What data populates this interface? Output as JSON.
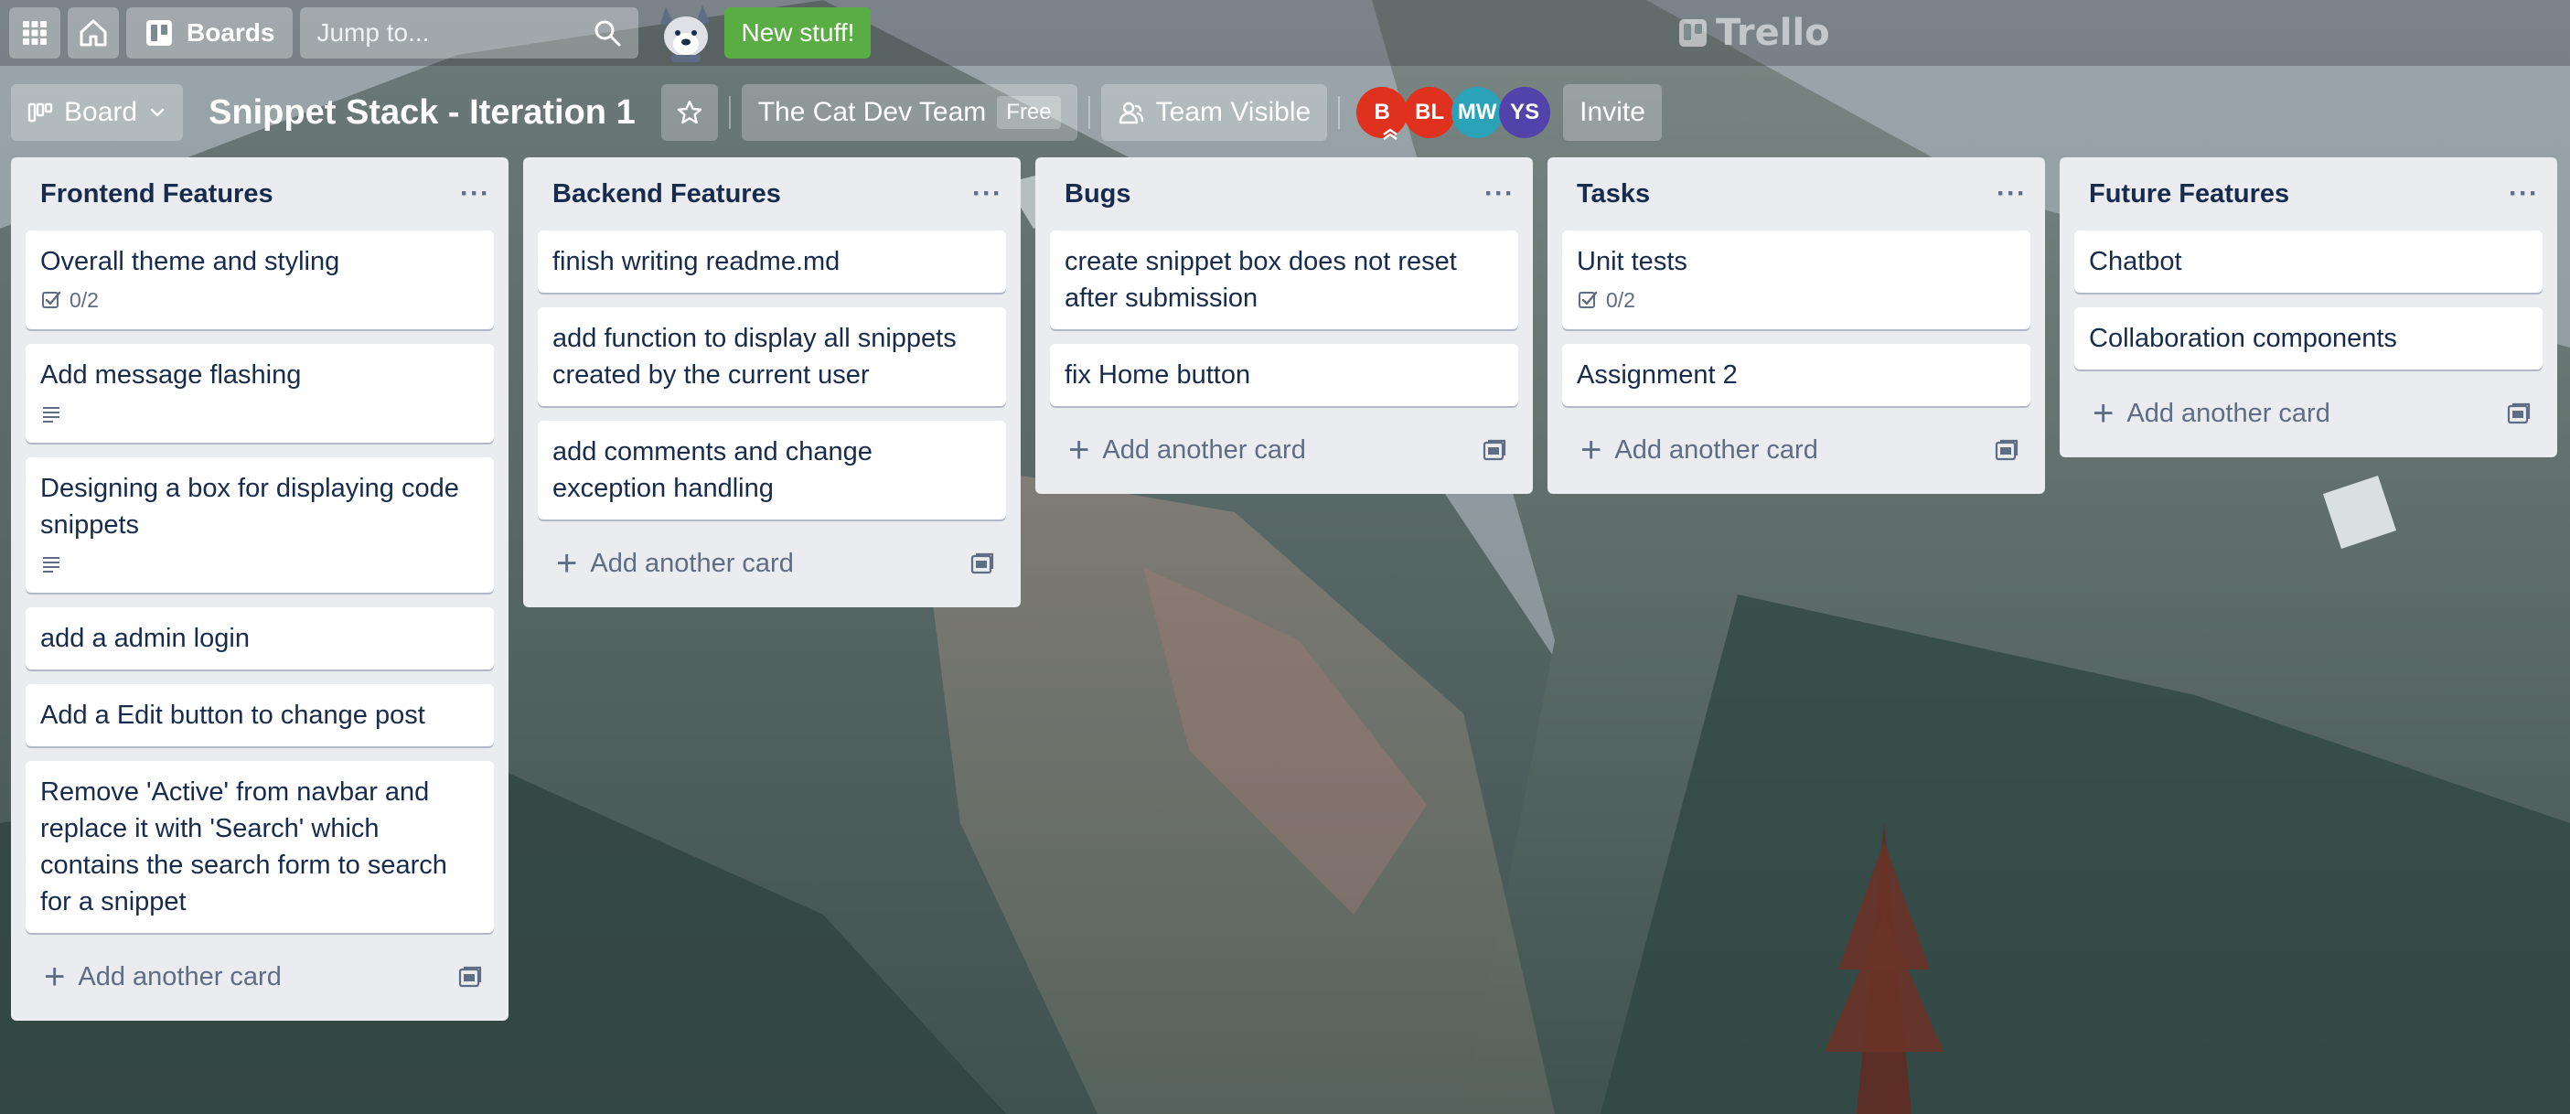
{
  "header": {
    "boards_label": "Boards",
    "search_placeholder": "Jump to...",
    "new_stuff_label": "New stuff!",
    "logo_text": "Trello"
  },
  "board": {
    "view_label": "Board",
    "title": "Snippet Stack - Iteration 1",
    "team_name": "The Cat Dev Team",
    "team_plan": "Free",
    "visibility_label": "Team Visible",
    "invite_label": "Invite",
    "members": [
      {
        "initials": "B",
        "color": "#e0301e"
      },
      {
        "initials": "BL",
        "color": "#e0301e"
      },
      {
        "initials": "MW",
        "color": "#2aa2b8"
      },
      {
        "initials": "YS",
        "color": "#5243aa"
      }
    ]
  },
  "add_card_label": "Add another card",
  "lists": [
    {
      "title": "Frontend Features",
      "cards": [
        {
          "title": "Overall theme and styling",
          "checklist": "0/2"
        },
        {
          "title": "Add message flashing",
          "description": true
        },
        {
          "title": "Designing a box for displaying code snippets",
          "description": true
        },
        {
          "title": "add a admin login"
        },
        {
          "title": "Add a Edit button to change post"
        },
        {
          "title": "Remove 'Active' from navbar and replace it with 'Search' which contains the search form to search for a snippet"
        }
      ]
    },
    {
      "title": "Backend Features",
      "cards": [
        {
          "title": "finish writing readme.md"
        },
        {
          "title": "add function to display all snippets created by the current user"
        },
        {
          "title": "add comments and change exception handling"
        }
      ]
    },
    {
      "title": "Bugs",
      "cards": [
        {
          "title": "create snippet box does not reset after submission"
        },
        {
          "title": "fix Home button"
        }
      ]
    },
    {
      "title": "Tasks",
      "cards": [
        {
          "title": "Unit tests",
          "checklist": "0/2"
        },
        {
          "title": "Assignment 2"
        }
      ]
    },
    {
      "title": "Future Features",
      "cards": [
        {
          "title": "Chatbot"
        },
        {
          "title": "Collaboration components"
        }
      ]
    }
  ]
}
